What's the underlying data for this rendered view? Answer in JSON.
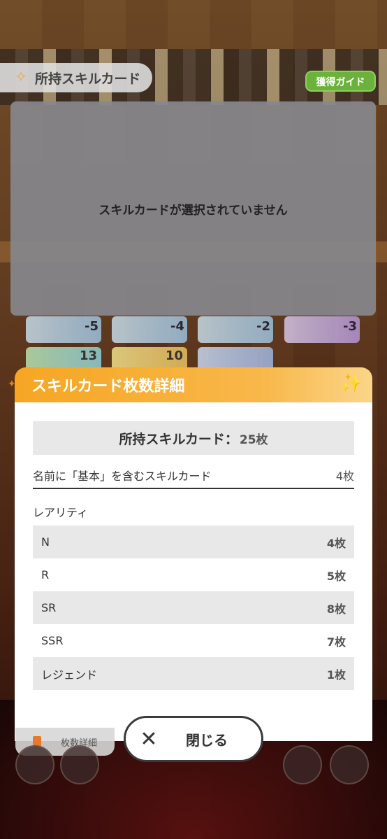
{
  "header": {
    "title": "所持スキルカード",
    "guide_button": "獲得ガイド"
  },
  "preview": {
    "empty_message": "スキルカードが選択されていません"
  },
  "background_cards": {
    "row1_costs": [
      "-5",
      "-4",
      "-2",
      "-3"
    ],
    "row2_numbers": [
      "13",
      "10"
    ]
  },
  "modal": {
    "title": "スキルカード枚数詳細",
    "total_label": "所持スキルカード：",
    "total_value": "25枚",
    "basic_label": "名前に「基本」を含むスキルカード",
    "basic_value": "4枚",
    "rarity_heading": "レアリティ",
    "rarities": [
      {
        "label": "N",
        "value": "4枚"
      },
      {
        "label": "R",
        "value": "5枚"
      },
      {
        "label": "SR",
        "value": "8枚"
      },
      {
        "label": "SSR",
        "value": "7枚"
      },
      {
        "label": "レジェンド",
        "value": "1枚"
      }
    ]
  },
  "footer": {
    "count_detail_button": "枚数詳細",
    "close_button": "閉じる"
  },
  "colors": {
    "accent_orange": "#f6a623",
    "guide_green": "#6bb13c"
  }
}
